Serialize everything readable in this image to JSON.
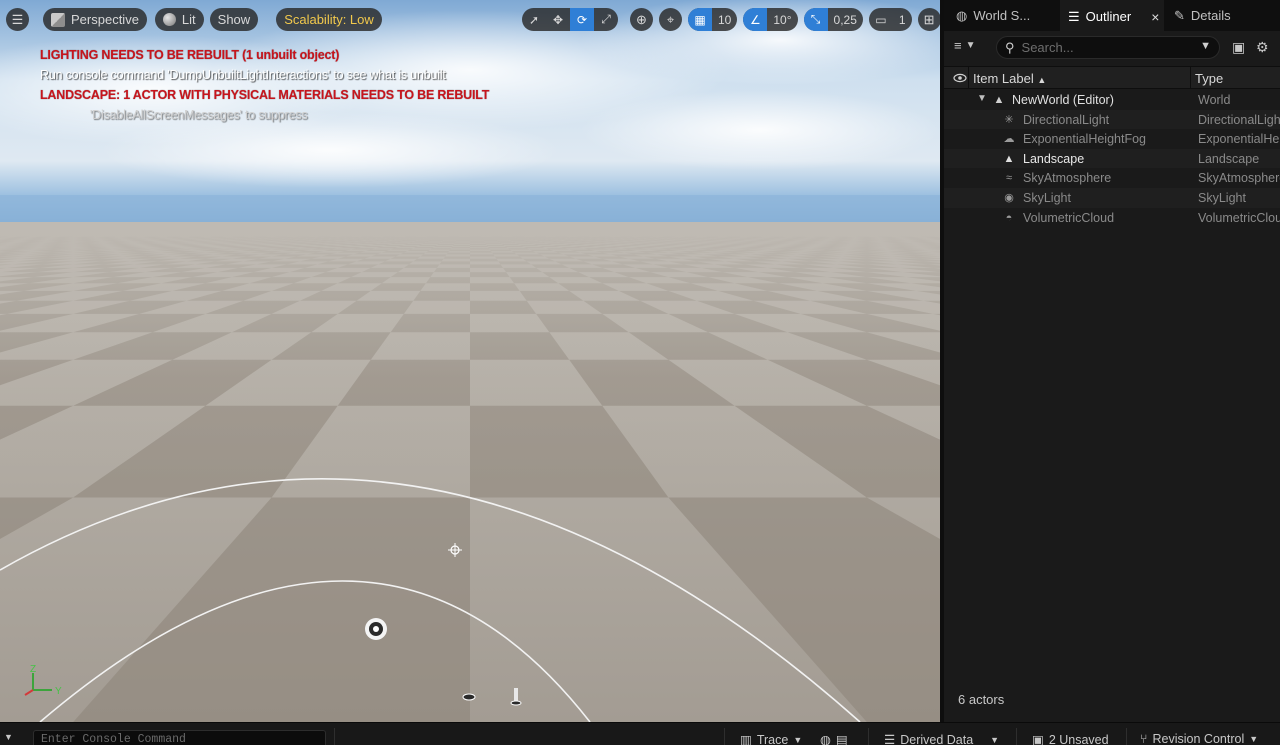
{
  "viewport": {
    "menu_icon": "hamburger-icon",
    "perspective_label": "Perspective",
    "lit_label": "Lit",
    "show_label": "Show",
    "scalability_label": "Scalability: Low",
    "grid_snap_value": "10",
    "rotation_snap_value": "10°",
    "scale_snap_value": "0,25",
    "camera_speed_value": "1",
    "messages": [
      "LIGHTING NEEDS TO BE REBUILT (1 unbuilt object)",
      "Run console command 'DumpUnbuiltLightInteractions' to see what is unbuilt",
      "LANDSCAPE: 1 ACTOR WITH PHYSICAL MATERIALS NEEDS TO BE REBUILT",
      "'DisableAllScreenMessages' to suppress"
    ],
    "axis_labels": {
      "z": "Z",
      "y": "Y"
    },
    "colors": {
      "error_red": "#c8141c",
      "active_blue": "#2f7fd6",
      "scalability_yellow": "#f2c94c"
    }
  },
  "panel": {
    "tabs": [
      {
        "label": "World S...",
        "icon": "globe-icon"
      },
      {
        "label": "Outliner",
        "icon": "outliner-icon"
      },
      {
        "label": "Details",
        "icon": "pencil-icon"
      }
    ],
    "search_placeholder": "Search...",
    "columns": {
      "item_label": "Item Label",
      "type": "Type"
    },
    "world": {
      "name": "NewWorld (Editor)",
      "type": "World"
    },
    "items": [
      {
        "name": "DirectionalLight",
        "type": "DirectionalLight",
        "icon": "sun-icon"
      },
      {
        "name": "ExponentialHeightFog",
        "type": "ExponentialHeightFog",
        "icon": "fog-icon"
      },
      {
        "name": "Landscape",
        "type": "Landscape",
        "icon": "mountain-icon"
      },
      {
        "name": "SkyAtmosphere",
        "type": "SkyAtmosphere",
        "icon": "sky-icon"
      },
      {
        "name": "SkyLight",
        "type": "SkyLight",
        "icon": "skylight-icon"
      },
      {
        "name": "VolumetricCloud",
        "type": "VolumetricCloud",
        "icon": "cloud-icon"
      }
    ],
    "footer": "6 actors"
  },
  "bottom_bar": {
    "console_placeholder": "Enter Console Command",
    "trace_label": "Trace",
    "derived_data_label": "Derived Data",
    "unsaved_label": "2 Unsaved",
    "revision_control_label": "Revision Control"
  }
}
